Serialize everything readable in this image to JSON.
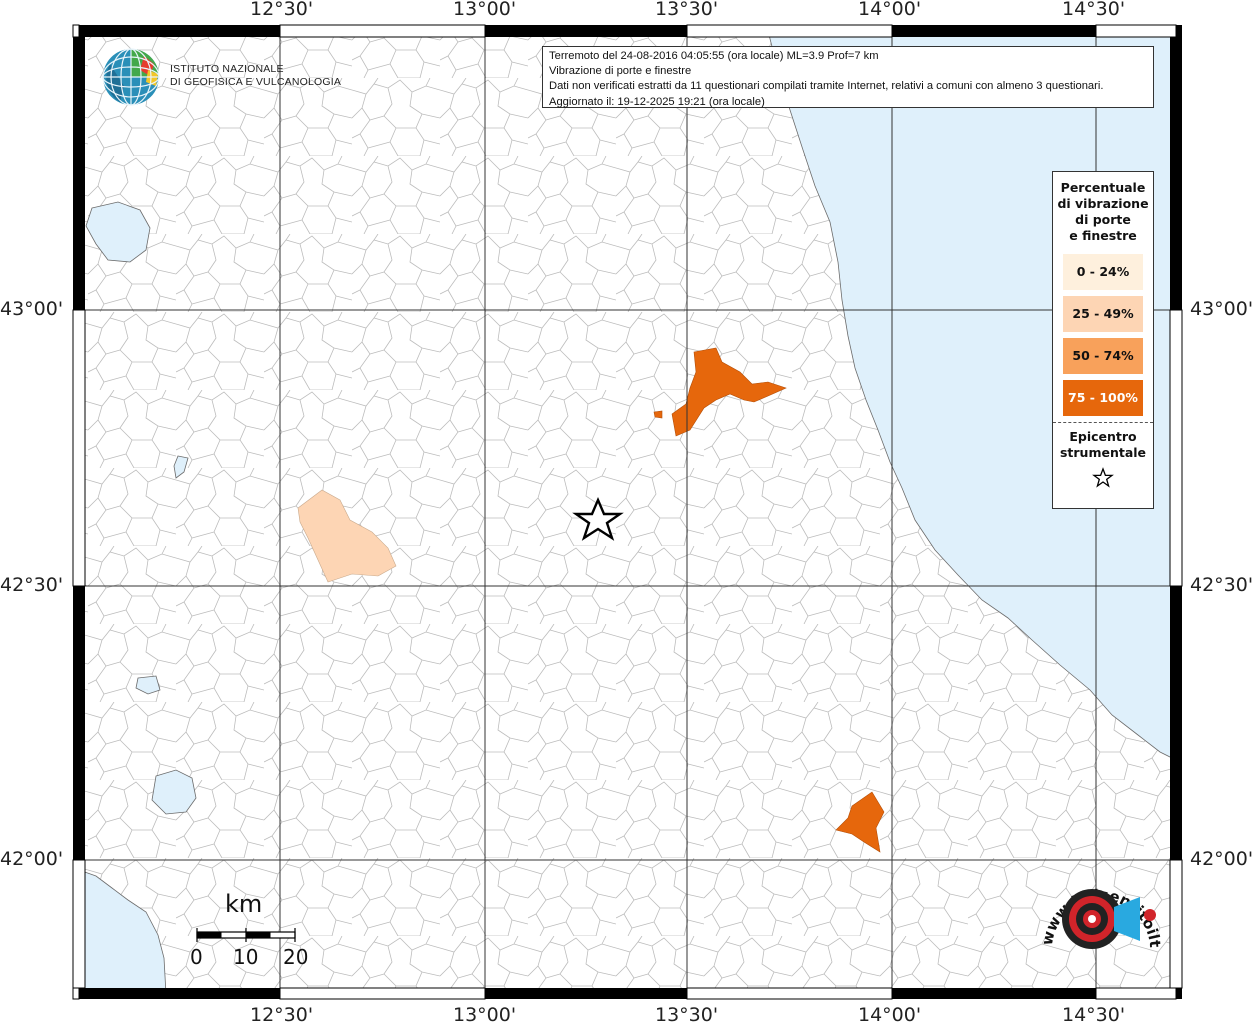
{
  "map": {
    "lon_labels": [
      "12°30'",
      "13°00'",
      "13°30'",
      "14°00'",
      "14°30'"
    ],
    "lat_labels": [
      "43°00'",
      "42°30'",
      "42°00'"
    ],
    "colors": {
      "sea": "#dff0fb",
      "border": "#b9b9b9",
      "grid": "#333333",
      "class_25_49": "#fdd5b4",
      "class_75_100": "#e6670c"
    }
  },
  "info_box": {
    "line1": "Terremoto del 24-08-2016 04:05:55 (ora locale) ML=3.9 Prof=7 km",
    "line2": "Vibrazione di porte e finestre",
    "line3": "Dati non verificati estratti da 11 questionari compilati tramite Internet, relativi a comuni con almeno 3 questionari.",
    "line4": "Aggiornato il: 19-12-2025 19:21 (ora locale)"
  },
  "legend": {
    "title_l1": "Percentuale",
    "title_l2": "di vibrazione",
    "title_l3": "di porte",
    "title_l4": "e finestre",
    "items": [
      {
        "label": "0 - 24%",
        "color": "#fef0dd",
        "text_color": "#111111"
      },
      {
        "label": "25 - 49%",
        "color": "#fdd5b4",
        "text_color": "#111111"
      },
      {
        "label": "50 - 74%",
        "color": "#f8a15b",
        "text_color": "#111111"
      },
      {
        "label": "75 - 100%",
        "color": "#e6670c",
        "text_color": "#ffffff"
      }
    ],
    "epicenter_l1": "Epicentro",
    "epicenter_l2": "strumentale",
    "star_icon": "star-outline-icon"
  },
  "ingv": {
    "line1": "ISTITUTO NAZIONALE",
    "line2": "DI GEOFISICA E VULCANOLOGIA"
  },
  "scale": {
    "title": "km",
    "labels": [
      "0",
      "10",
      "20"
    ]
  },
  "hst": {
    "text": "www.haisentitoilterremoto.it"
  }
}
